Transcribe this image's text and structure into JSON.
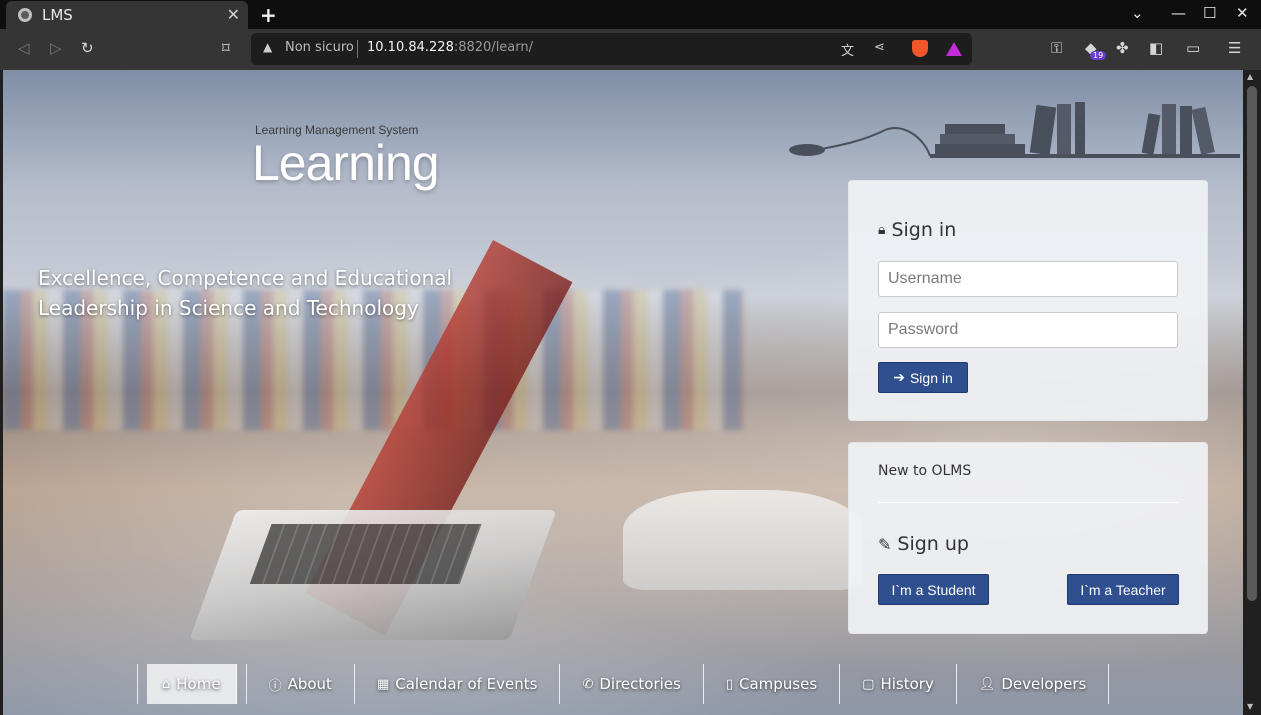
{
  "browser": {
    "tab_title": "LMS",
    "tab_close": "✕",
    "new_tab": "+",
    "security_label": "Non sicuro",
    "url_host": "10.10.84.228",
    "url_rest": ":8820/learn/",
    "ext_badge": "19"
  },
  "brand": {
    "subtitle": "Learning Management System",
    "title": "Learning"
  },
  "tagline": "Excellence, Competence and Educational Leadership in Science and Technology",
  "signin": {
    "title": "Sign in",
    "username_placeholder": "Username",
    "password_placeholder": "Password",
    "button_label": "Sign in"
  },
  "signup": {
    "intro": "New to OLMS",
    "title": "Sign up",
    "student_button": "I`m a Student",
    "teacher_button": "I`m a Teacher"
  },
  "menu": {
    "items": [
      {
        "label": "Home",
        "icon": "home-icon"
      },
      {
        "label": "About",
        "icon": "info-icon"
      },
      {
        "label": "Calendar of Events",
        "icon": "calendar-icon"
      },
      {
        "label": "Directories",
        "icon": "phone-icon"
      },
      {
        "label": "Campuses",
        "icon": "building-icon"
      },
      {
        "label": "History",
        "icon": "file-icon"
      },
      {
        "label": "Developers",
        "icon": "user-icon"
      }
    ]
  },
  "colors": {
    "primary_button": "#2f4f8f",
    "browser_bg": "#353535"
  }
}
